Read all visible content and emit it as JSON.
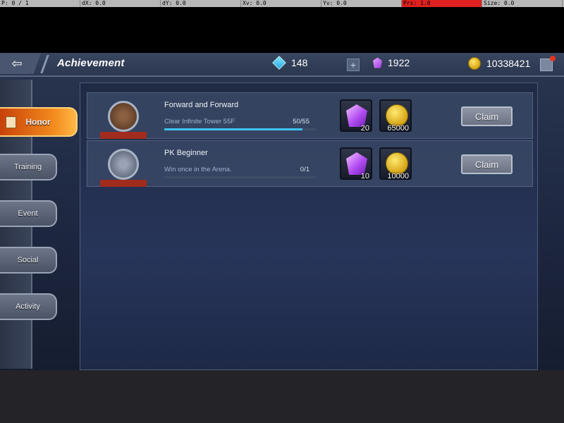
{
  "debug_bar": {
    "pointer": "P: 0 / 1",
    "dx": "dX: 0.0",
    "dy": "dY: 0.0",
    "xv": "Xv: 0.0",
    "yv": "Yv: 0.0",
    "prs": "Prs: 1.0",
    "size": "Size: 0.0"
  },
  "header": {
    "title": "Achievement",
    "diamonds": "148",
    "gems": "1922",
    "gold": "10338421"
  },
  "tabs": [
    {
      "label": "Honor",
      "active": true
    },
    {
      "label": "Training",
      "active": false
    },
    {
      "label": "Event",
      "active": false
    },
    {
      "label": "Social",
      "active": false
    },
    {
      "label": "Activity",
      "active": false
    }
  ],
  "achievements": [
    {
      "title": "Forward and Forward",
      "description": "Clear Infinite Tower 55F",
      "progress_text": "50/55",
      "progress_fraction": 0.909,
      "rewards": [
        {
          "icon": "purple-gem",
          "qty": "20"
        },
        {
          "icon": "gold-coin",
          "qty": "65000"
        }
      ],
      "button": "Claim"
    },
    {
      "title": "PK Beginner",
      "description": "Win once in the Arena.",
      "progress_text": "0/1",
      "progress_fraction": 0,
      "rewards": [
        {
          "icon": "purple-gem",
          "qty": "10"
        },
        {
          "icon": "gold-coin",
          "qty": "10000"
        }
      ],
      "button": "Claim"
    }
  ],
  "colors": {
    "progress_fill": "#3ec3f0",
    "active_tab": "#f38a1d",
    "notification_dot": "#e8331f"
  }
}
